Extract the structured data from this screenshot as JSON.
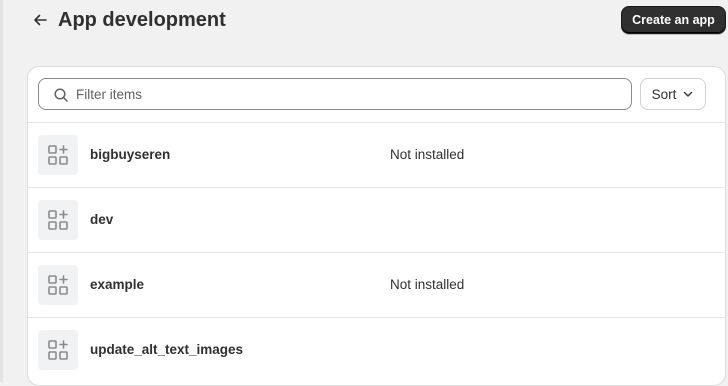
{
  "header": {
    "title": "App development",
    "back_icon": "arrow-left-icon",
    "create_button_label": "Create an app"
  },
  "filter": {
    "placeholder": "Filter items",
    "value": "",
    "search_icon": "search-icon",
    "sort_label": "Sort",
    "sort_icon": "chevron-down-icon"
  },
  "apps": [
    {
      "name": "bigbuyseren",
      "status": "Not installed",
      "icon": "apps-icon"
    },
    {
      "name": "dev",
      "status": "",
      "icon": "apps-icon"
    },
    {
      "name": "example",
      "status": "Not installed",
      "icon": "apps-icon"
    },
    {
      "name": "update_alt_text_images",
      "status": "",
      "icon": "apps-icon"
    }
  ],
  "colors": {
    "background": "#f1f1f1",
    "primary_button": "#303030",
    "icon_tile": "#f1f2f4",
    "icon_stroke": "#8a8a8a"
  }
}
